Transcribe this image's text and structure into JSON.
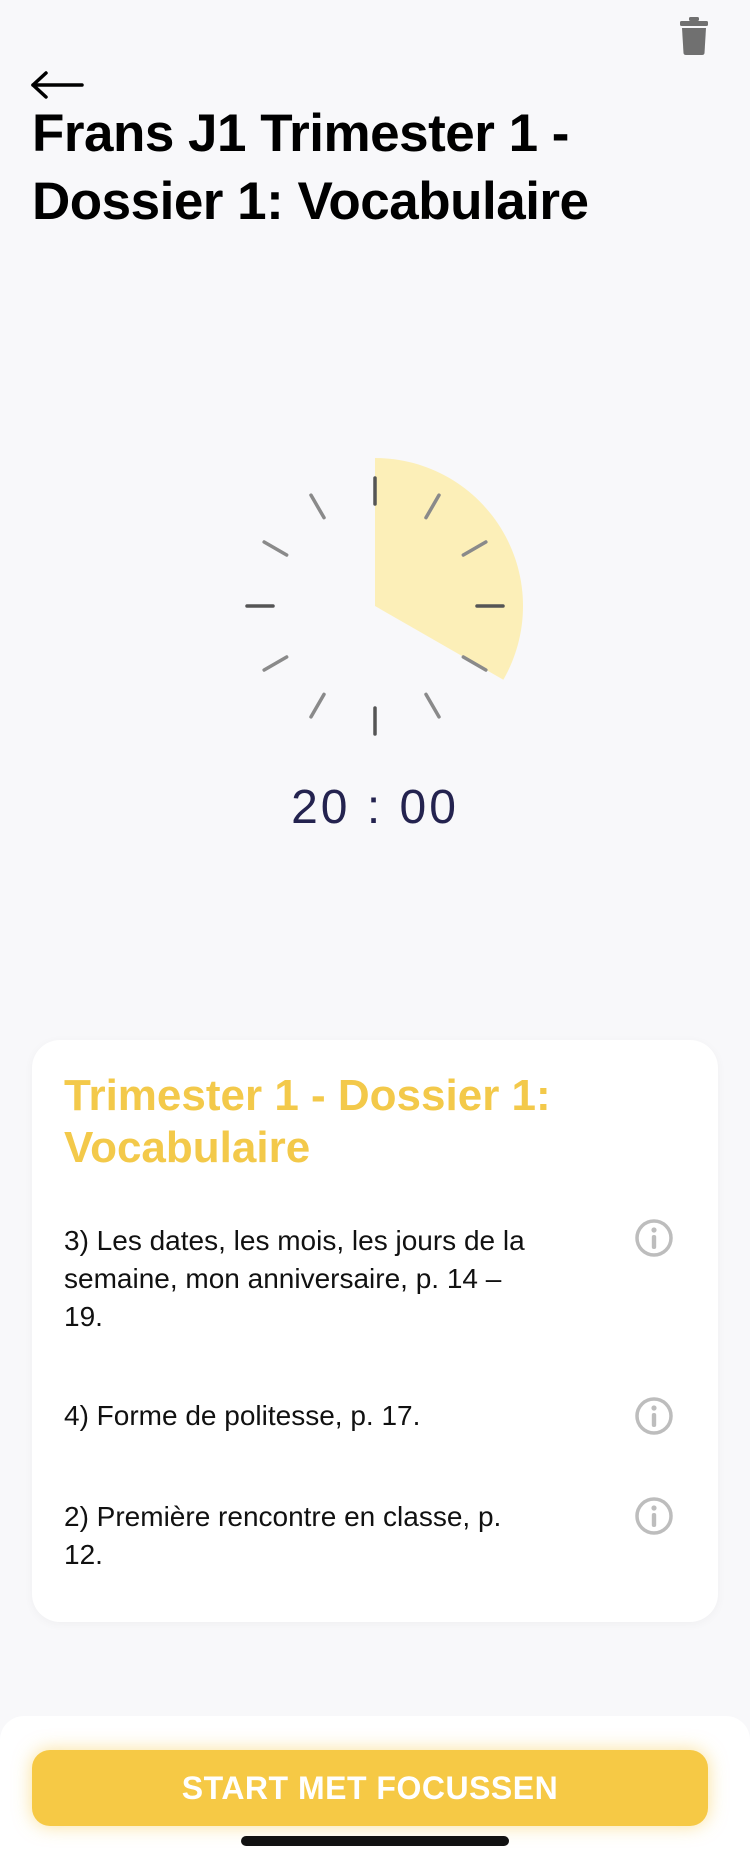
{
  "header": {
    "title": "Frans J1 Trimester 1 - Dossier 1: Vocabulaire",
    "back_icon": "arrow-left-icon",
    "delete_icon": "trash-icon"
  },
  "timer": {
    "display": "20 : 00",
    "filled_fraction": 0.333,
    "fill_color": "#fcefb8"
  },
  "card": {
    "title": "Trimester 1 - Dossier 1: Vocabulaire",
    "items": [
      {
        "text": "3) Les dates, les mois, les jours de la semaine, mon anniversaire, p. 14 – 19.",
        "icon": "info-icon"
      },
      {
        "text": "4) Forme de politesse, p. 17.",
        "icon": "info-icon"
      },
      {
        "text": "2) Première rencontre en classe, p. 12.",
        "icon": "info-icon"
      }
    ]
  },
  "footer": {
    "start_label": "START MET FOCUSSEN"
  },
  "colors": {
    "accent": "#f6c945",
    "card_title": "#f3c94a",
    "timer_text": "#24234f"
  }
}
